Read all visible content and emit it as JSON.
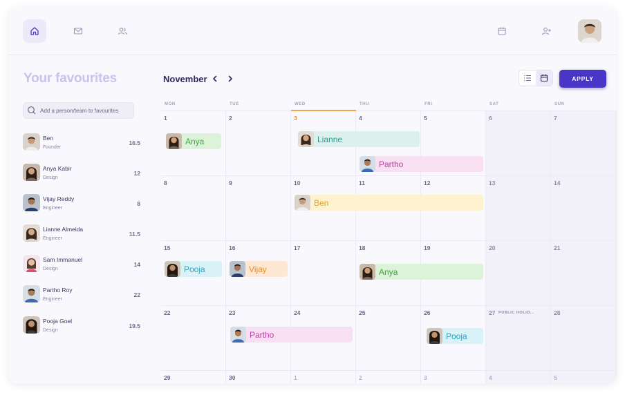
{
  "nav": {
    "left_icons": [
      "home-icon",
      "mail-icon",
      "team-icon"
    ],
    "right_icons": [
      "calendar-icon",
      "add-user-icon"
    ]
  },
  "sidebar": {
    "title": "Your favourites",
    "search_placeholder": "Add a person/team to favourites",
    "people": [
      {
        "name": "Ben",
        "role": "Founder",
        "hours": "16.5"
      },
      {
        "name": "Anya Kabir",
        "role": "Design",
        "hours": "12"
      },
      {
        "name": "Vijay Reddy",
        "role": "Engineer",
        "hours": "8"
      },
      {
        "name": "Lianne Almeida",
        "role": "Engineer",
        "hours": "11.5"
      },
      {
        "name": "Sam Immanuel",
        "role": "Design",
        "hours": "14"
      },
      {
        "name": "Partho Roy",
        "role": "Engineer",
        "hours": "22"
      },
      {
        "name": "Pooja Goel",
        "role": "Design",
        "hours": "19.5"
      }
    ]
  },
  "header": {
    "month": "November",
    "apply_label": "APPLY"
  },
  "calendar": {
    "weekdays": [
      "MON",
      "TUE",
      "WED",
      "THU",
      "FRI",
      "SAT",
      "SUN"
    ],
    "weeks": [
      [
        "1",
        "2",
        "3",
        "4",
        "5",
        "6",
        "7"
      ],
      [
        "8",
        "9",
        "10",
        "11",
        "12",
        "13",
        "14"
      ],
      [
        "15",
        "16",
        "17",
        "18",
        "19",
        "20",
        "21"
      ],
      [
        "22",
        "23",
        "24",
        "25",
        "26",
        "27",
        "28"
      ],
      [
        "29",
        "30",
        "1",
        "2",
        "3",
        "4",
        "5"
      ]
    ],
    "holiday_label": "PUBLIC HOLID...",
    "events": [
      {
        "name": "Anya"
      },
      {
        "name": "Lianne"
      },
      {
        "name": "Partho"
      },
      {
        "name": "Ben"
      },
      {
        "name": "Pooja"
      },
      {
        "name": "Vijay"
      },
      {
        "name": "Anya"
      },
      {
        "name": "Partho"
      },
      {
        "name": "Pooja"
      }
    ]
  },
  "colors": {
    "accent": "#4a36c6",
    "today": "#e8902c",
    "favourites_title": "#c9c1ee"
  }
}
